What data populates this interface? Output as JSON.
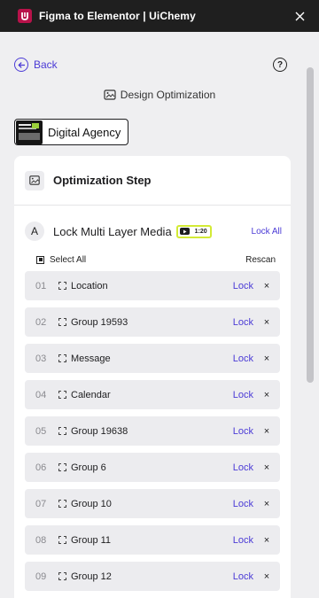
{
  "titlebar": {
    "title": "Figma to Elementor | UiChemy",
    "logo_icon": "uichemy-logo",
    "close_icon": "close-icon",
    "brand_color": "#b8124a"
  },
  "nav": {
    "back_label": "Back",
    "help_label": "?"
  },
  "section": {
    "title": "Design Optimization"
  },
  "project": {
    "name": "Digital Agency"
  },
  "panel": {
    "step_title": "Optimization Step",
    "lock_section": {
      "letter": "A",
      "title": "Lock Multi Layer Media",
      "badge_text": "1:20",
      "lock_all_label": "Lock All"
    },
    "select_all_label": "Select All",
    "rescan_label": "Rescan",
    "lock_label": "Lock",
    "remove_glyph": "×",
    "layers": [
      {
        "num": "01",
        "name": "Location"
      },
      {
        "num": "02",
        "name": "Group 19593"
      },
      {
        "num": "03",
        "name": "Message"
      },
      {
        "num": "04",
        "name": "Calendar"
      },
      {
        "num": "05",
        "name": "Group 19638"
      },
      {
        "num": "06",
        "name": "Group 6"
      },
      {
        "num": "07",
        "name": "Group 10"
      },
      {
        "num": "08",
        "name": "Group 11"
      },
      {
        "num": "09",
        "name": "Group 12"
      }
    ]
  },
  "colors": {
    "accent": "#4b3bd6",
    "badge_border": "#d3ea35",
    "titlebar_bg": "#1f1f1f"
  }
}
